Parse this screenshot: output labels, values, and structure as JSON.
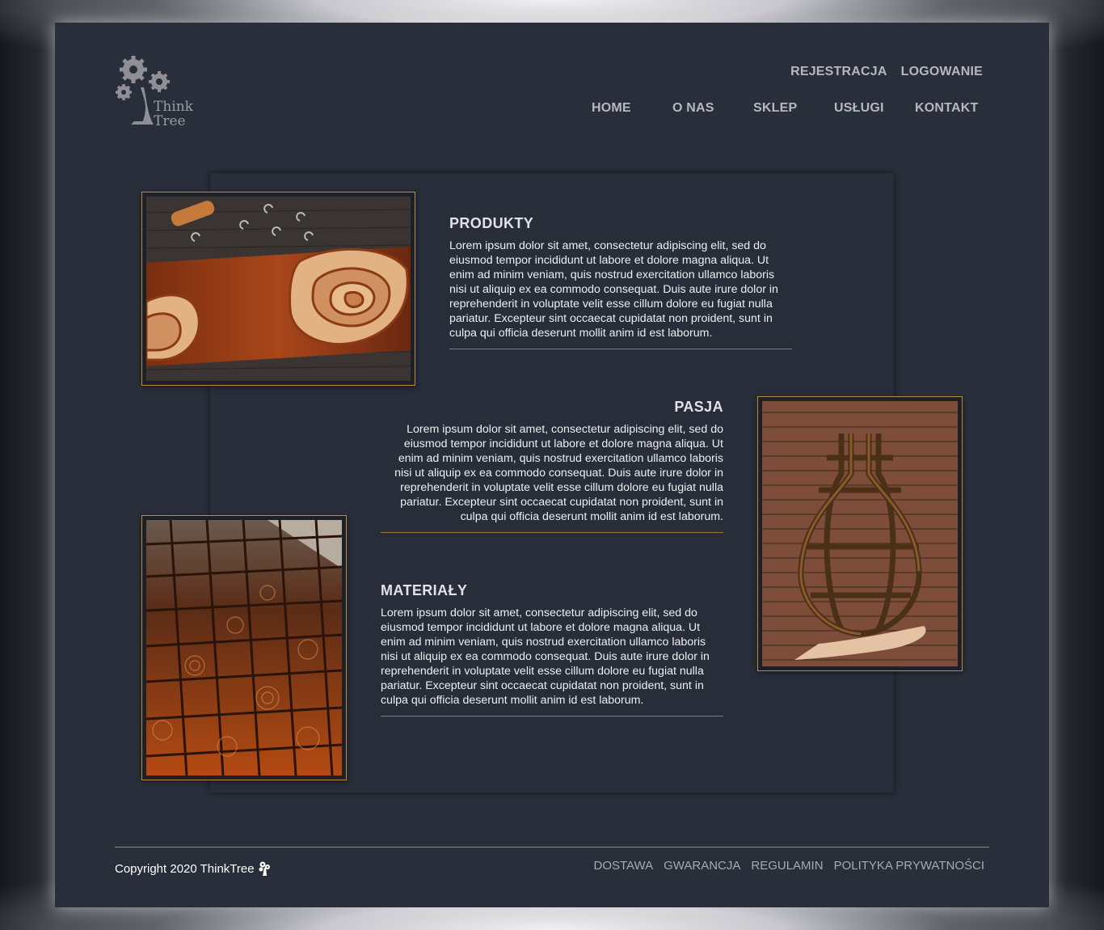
{
  "brand": {
    "name_line1": "Think",
    "name_line2": "Tree",
    "logo_icon": "gears-tree-icon"
  },
  "topnav": [
    {
      "label": "REJESTRACJA"
    },
    {
      "label": "LOGOWANIE"
    }
  ],
  "mainnav": [
    {
      "label": "HOME"
    },
    {
      "label": "O NAS"
    },
    {
      "label": "SKLEP"
    },
    {
      "label": "USŁUGI"
    },
    {
      "label": "KONTAKT"
    }
  ],
  "sections": [
    {
      "title": "PRODUKTY",
      "text": "Lorem ipsum dolor sit amet, consectetur adipiscing elit, sed do eiusmod tempor incididunt ut labore et dolore magna aliqua. Ut enim ad minim veniam, quis nostrud exercitation ullamco laboris nisi ut aliquip ex ea commodo consequat. Duis aute irure dolor in reprehenderit in voluptate velit esse cillum dolore eu fugiat nulla pariatur. Excepteur sint occaecat cupidatat non proident, sunt in culpa qui officia deserunt mollit anim id est laborum."
    },
    {
      "title": "PASJA",
      "text": "Lorem ipsum dolor sit amet, consectetur adipiscing elit, sed do eiusmod tempor incididunt ut labore et dolore magna aliqua. Ut enim ad minim veniam, quis nostrud exercitation ullamco laboris nisi ut aliquip ex ea commodo consequat. Duis aute irure dolor in reprehenderit in voluptate velit esse cillum dolore eu fugiat nulla pariatur. Excepteur sint occaecat cupidatat non proident, sunt in culpa qui officia deserunt mollit anim id est laborum."
    },
    {
      "title": "MATERIAŁY",
      "text": "Lorem ipsum dolor sit amet, consectetur adipiscing elit, sed do eiusmod tempor incididunt ut labore et dolore magna aliqua. Ut enim ad minim veniam, quis nostrud exercitation ullamco laboris nisi ut aliquip ex ea commodo consequat. Duis aute irure dolor in reprehenderit in voluptate velit esse cillum dolore eu fugiat nulla pariatur. Excepteur sint occaecat cupidatat non proident, sunt in culpa qui officia deserunt mollit anim id est laborum."
    }
  ],
  "footer": {
    "copyright": "Copyright 2020 ThinkTree",
    "copyright_icon": "gears-tree-icon",
    "links": [
      {
        "label": "DOSTAWA"
      },
      {
        "label": "GWARANCJA"
      },
      {
        "label": "REGULAMIN"
      },
      {
        "label": "POLITYKA PRYWATNOŚCI"
      }
    ]
  },
  "colors": {
    "page_bg": "#282e3a",
    "accent": "#c08a3a",
    "nav_text": "#b7b7bc"
  }
}
